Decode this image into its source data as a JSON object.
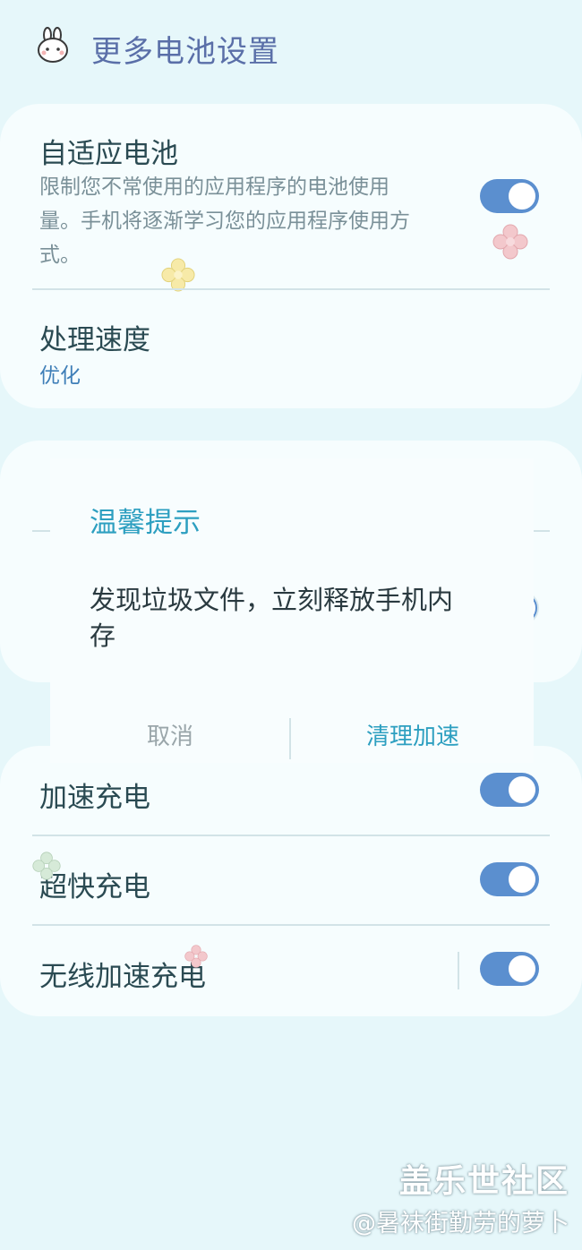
{
  "header": {
    "title": "更多电池设置",
    "icon": "bunny-icon"
  },
  "adaptive": {
    "title": "自适应电池",
    "desc_lines": [
      "限制您不常使用的应用程序的电池使用",
      "量。手机将逐渐学习您的应用程序使用方",
      "式。"
    ],
    "enabled": true
  },
  "processing": {
    "title": "处理速度",
    "value": "优化"
  },
  "dialog": {
    "title": "温馨提示",
    "message": "发现垃圾文件，立刻释放手机内存",
    "cancel_label": "取消",
    "confirm_label": "清理加速"
  },
  "charging": {
    "fast_charge": {
      "title": "加速充电",
      "enabled": true
    },
    "super_fast": {
      "title": "超快充电",
      "enabled": true
    },
    "wireless_fast": {
      "title": "无线加速充电",
      "enabled": true
    }
  },
  "watermark": {
    "brand": "盖乐世社区",
    "author": "@暑袜街勤劳的萝卜"
  },
  "colors": {
    "accent": "#5b8fcf",
    "dialog_accent": "#2d9fc0",
    "background": "#e6f7fa"
  }
}
